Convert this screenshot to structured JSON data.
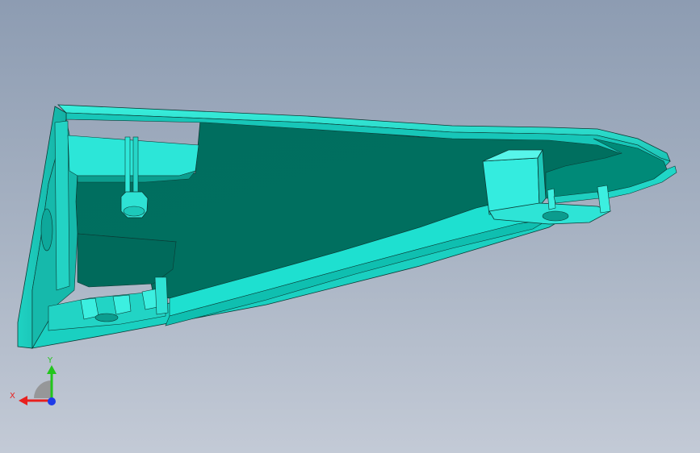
{
  "viewport": {
    "background_top": "#8d9cb2",
    "background_bottom": "#c3cad6",
    "model_colors": {
      "light": "#2be0d2",
      "mid": "#1fc3b6",
      "dark": "#007262",
      "darker": "#005b4e",
      "edge": "#0b3a34"
    }
  },
  "triad": {
    "x_label": "X",
    "y_label": "Y",
    "x_color": "#e8201e",
    "y_color": "#22c61c",
    "z_color": "#1e3be8",
    "x_icon": "x-axis-arrow",
    "y_icon": "y-axis-arrow",
    "z_icon": "z-axis-dot"
  }
}
